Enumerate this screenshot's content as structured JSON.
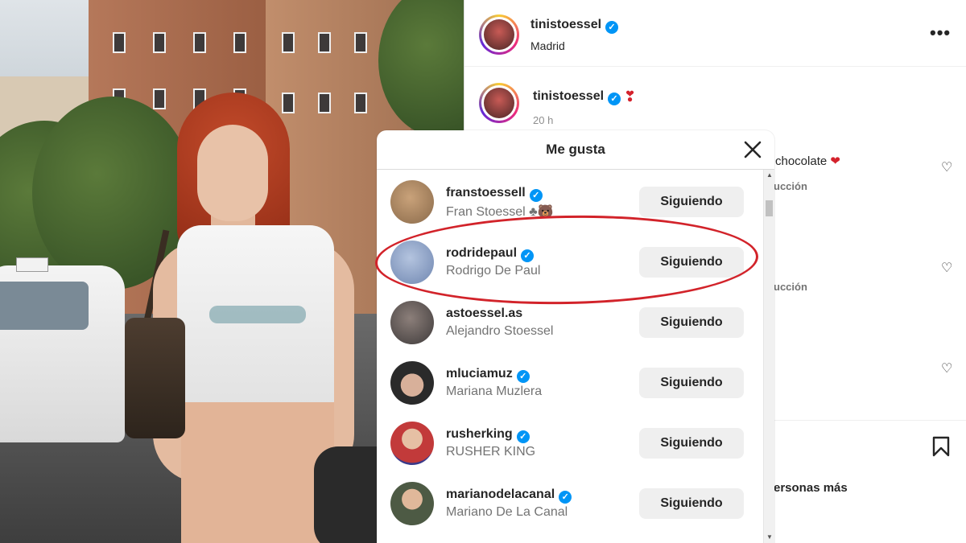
{
  "post": {
    "author": "tinistoessel",
    "location": "Madrid",
    "caption_author": "tinistoessel",
    "caption_time": "20 h",
    "comment_fragment": "chocolate",
    "reply_fragment_1": "ucción",
    "reply_fragment_2": "ucción",
    "likes_fragment": "ersonas más"
  },
  "modal": {
    "title": "Me gusta",
    "rows": [
      {
        "username": "franstoessell",
        "verified": true,
        "full_name": "Fran Stoessel ♣🐻",
        "button": "Siguiendo",
        "avatar_color": "#8a6a4a"
      },
      {
        "username": "rodridepaul",
        "verified": true,
        "full_name": "Rodrigo De Paul",
        "button": "Siguiendo",
        "avatar_color": "#6f86b0"
      },
      {
        "username": "astoessel.as",
        "verified": false,
        "full_name": "Alejandro Stoessel",
        "button": "Siguiendo",
        "avatar_color": "#3e3a3a"
      },
      {
        "username": "mluciamuz",
        "verified": true,
        "full_name": "Mariana Muzlera",
        "button": "Siguiendo",
        "avatar_color": "#2a2a2a"
      },
      {
        "username": "rusherking",
        "verified": true,
        "full_name": "RUSHER KING",
        "button": "Siguiendo",
        "avatar_color": "#c23a3a"
      },
      {
        "username": "marianodelacanal",
        "verified": true,
        "full_name": "Mariano De La Canal",
        "button": "Siguiendo",
        "avatar_color": "#4d5a44"
      }
    ]
  },
  "colors": {
    "verified": "#0095f6",
    "highlight": "#d2232a",
    "heart": "#d4222c"
  }
}
